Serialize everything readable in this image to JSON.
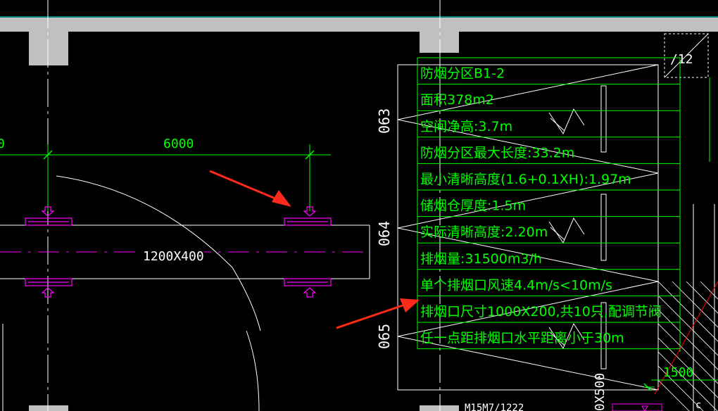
{
  "drawing": {
    "dimension_left": "0",
    "dimension_mid": "6000",
    "duct_label": "1200X400",
    "elevation_labels": [
      "063",
      "064",
      "065"
    ],
    "grid_bubble": "/12",
    "dim_bottom_right": "1500",
    "dim_bottom_left": "0X500",
    "bottom_text": "M15M7/1222",
    "bottom_right_char": "c",
    "table_rows": [
      "防烟分区B1-2",
      "面积378m2",
      "空间净高:3.7m",
      "防烟分区最大长度:33.2m",
      "最小清晰高度(1.6+0.1XH):1.97m",
      "储烟仓厚度:1.5m",
      "实际清晰高度:2.20m",
      "排烟量:31500m3/h",
      "单个排烟口风速4.4m/s<10m/s",
      "排烟口尺寸1000X200,共10只,配调节阀",
      "任一点距排烟口水平距离小于30m"
    ]
  },
  "colors": {
    "background": "#000000",
    "green": "#00ff00",
    "magenta": "#ff00ff",
    "white": "#ffffff",
    "gray": "#c0c0c0",
    "red": "#ff0000",
    "cyan": "#00ffff",
    "arrow": "#ff2a1a"
  }
}
